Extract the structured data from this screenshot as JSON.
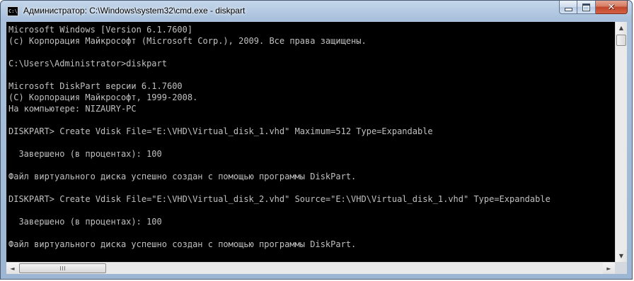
{
  "window": {
    "title": "Администратор: C:\\Windows\\system32\\cmd.exe - diskpart",
    "icon_label": "C:\\.",
    "minimize_glyph": "",
    "maximize_glyph": "",
    "close_glyph": "✕"
  },
  "colors": {
    "console_bg": "#000000",
    "console_fg": "#c0c0c0",
    "titlebar": "#a9c1dc",
    "close_button": "#c0452a"
  },
  "console": {
    "lines": [
      "Microsoft Windows [Version 6.1.7600]",
      "(c) Корпорация Майкрософт (Microsoft Corp.), 2009. Все права защищены.",
      "",
      "C:\\Users\\Administrator>diskpart",
      "",
      "Microsoft DiskPart версии 6.1.7600",
      "(C) Корпорация Майкрософт, 1999-2008.",
      "На компьютере: NIZAURY-PC",
      "",
      "DISKPART> Create Vdisk File=\"E:\\VHD\\Virtual_disk_1.vhd\" Maximum=512 Type=Expandable",
      "",
      "  Завершено (в процентах): 100",
      "",
      "Файл виртуального диска успешно создан с помощью программы DiskPart.",
      "",
      "DISKPART> Create Vdisk File=\"E:\\VHD\\Virtual_disk_2.vhd\" Source=\"E:\\VHD\\Virtual_disk_1.vhd\" Type=Expandable",
      "",
      "  Завершено (в процентах): 100",
      "",
      "Файл виртуального диска успешно создан с помощью программы DiskPart.",
      ""
    ]
  },
  "scrollbars": {
    "up_arrow": "▲",
    "down_arrow": "▼",
    "left_arrow": "◄",
    "right_arrow": "►"
  }
}
